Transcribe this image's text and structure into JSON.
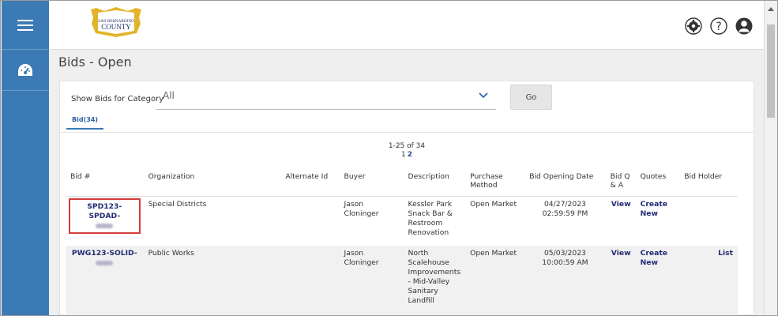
{
  "logo": {
    "line1": "SAN BERNARDINO",
    "line2": "COUNTY"
  },
  "page_title": "Bids - Open",
  "filter": {
    "label": "Show Bids for Category",
    "value": "All",
    "go_label": "Go"
  },
  "tab": {
    "label": "Bid(34)"
  },
  "pager": {
    "range": "1-25 of 34",
    "pages": [
      "1",
      "2"
    ],
    "current": "2"
  },
  "table": {
    "headers": [
      "Bid #",
      "Organization",
      "Alternate Id",
      "Buyer",
      "Description",
      "Purchase Method",
      "Bid Opening Date",
      "Bid Q & A",
      "Quotes",
      "Bid Holder"
    ],
    "rows": [
      {
        "bid": "SPD123-SPDAD-",
        "organization": "Special Districts",
        "alternate_id": "",
        "buyer": "Jason Cloninger",
        "description": "Kessler Park Snack Bar & Restroom Renovation",
        "method": "Open Market",
        "opening": "04/27/2023 02:59:59 PM",
        "qa": "View",
        "quotes": "Create New",
        "holder": ""
      },
      {
        "bid": "PWG123-SOLID-",
        "organization": "Public Works",
        "alternate_id": "",
        "buyer": "Jason Cloninger",
        "description": "North Scalehouse Improvements - Mid-Valley Sanitary Landfill",
        "method": "Open Market",
        "opening": "05/03/2023 10:00:59 AM",
        "qa": "View",
        "quotes": "Create New",
        "holder": "List"
      }
    ]
  }
}
